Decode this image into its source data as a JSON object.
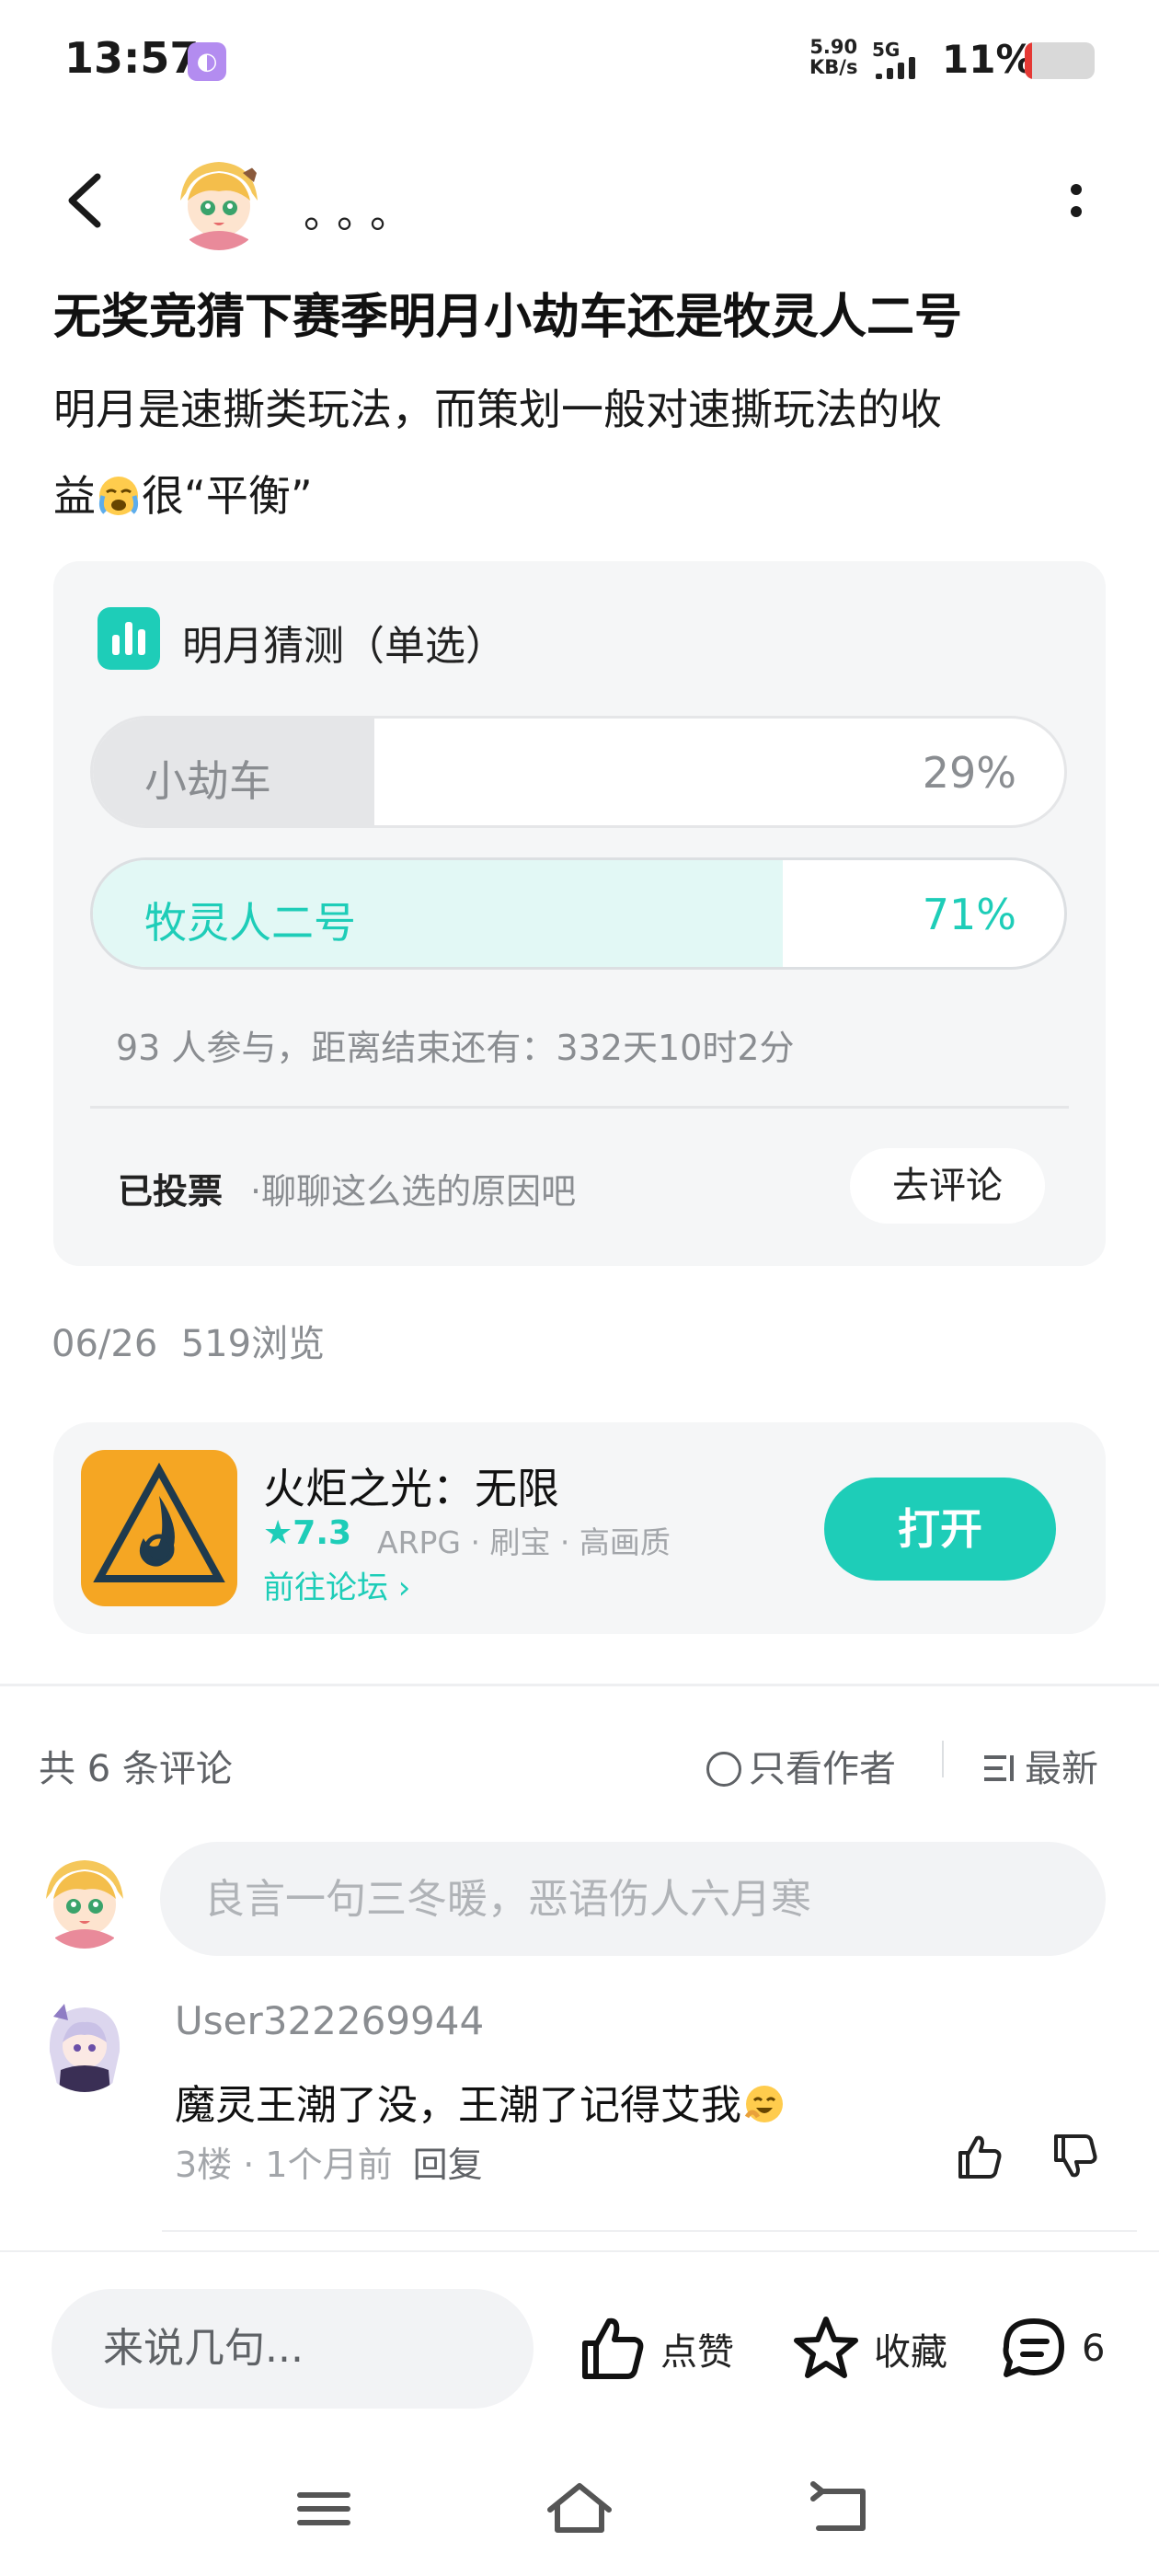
{
  "status_bar": {
    "time": "13:57",
    "speed_value": "5.90",
    "speed_unit": "KB/s",
    "network": "5G",
    "battery": "11%",
    "battery_level": 0.11,
    "battery_color": "#e53935"
  },
  "header": {
    "author_name": "。。。"
  },
  "post": {
    "title": "无奖竞猜下赛季明月小劫车还是牧灵人二号",
    "body_line1": "明月是速撕类玩法，而策划一般对速撕玩法的收",
    "body_line2_a": "益",
    "body_line2_b": "很“平衡”"
  },
  "poll": {
    "title": "明月猜测（单选）",
    "options": [
      {
        "label": "小劫车",
        "percent_text": "29%",
        "percent": 29
      },
      {
        "label": "牧灵人二号",
        "percent_text": "71%",
        "percent": 71
      }
    ],
    "stats": "93 人参与，距离结束还有：332天10时2分",
    "voted_label": "已投票",
    "voted_hint": "·聊聊这么选的原因吧",
    "comment_button": "去评论"
  },
  "meta": {
    "date": "06/26",
    "views": "519浏览"
  },
  "app_card": {
    "name": "火炬之光：无限",
    "rating": "★7.3",
    "tags": "ARPG · 刷宝 · 高画质",
    "forum_link": "前往论坛 ›",
    "open_button": "打开"
  },
  "comments_header": {
    "count": "共 6 条评论",
    "only_author": "只看作者",
    "sort": "最新"
  },
  "comment_input": {
    "placeholder": "良言一句三冬暖，恶语伤人六月寒"
  },
  "comments": [
    {
      "user": "User322269944",
      "text": "魔灵王潮了没，王潮了记得艾我",
      "floor_time": "3楼 · 1个月前",
      "reply": "回复"
    }
  ],
  "bottom_bar": {
    "input_placeholder": "来说几句...",
    "like": "点赞",
    "favorite": "收藏",
    "comment_count": "6"
  },
  "colors": {
    "accent": "#1ecdb8",
    "poll_bar_grey": "#e5e6e8",
    "poll_bar_teal": "#e2f8f5",
    "card_bg": "#f5f6f7"
  }
}
